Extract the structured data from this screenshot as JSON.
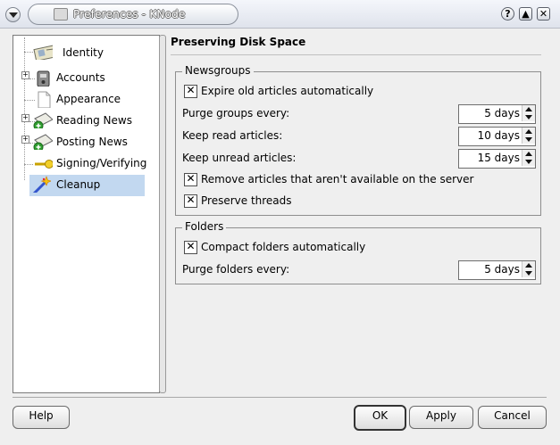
{
  "window": {
    "title": "Preferences - KNode",
    "help_glyph": "?",
    "shade_glyph": "▲",
    "close_glyph": "✕"
  },
  "tree": {
    "items": [
      {
        "label": "Identity",
        "icon": "identity-card-icon",
        "expandable": false
      },
      {
        "label": "Accounts",
        "icon": "accounts-icon",
        "expandable": true
      },
      {
        "label": "Appearance",
        "icon": "appearance-document-icon",
        "expandable": false
      },
      {
        "label": "Reading News",
        "icon": "reading-news-icon",
        "expandable": true
      },
      {
        "label": "Posting News",
        "icon": "posting-news-icon",
        "expandable": true
      },
      {
        "label": "Signing/Verifying",
        "icon": "key-icon",
        "expandable": false
      },
      {
        "label": "Cleanup",
        "icon": "magic-wand-icon",
        "expandable": false,
        "selected": true
      }
    ],
    "expander_glyph": "+"
  },
  "page": {
    "title": "Preserving Disk Space",
    "newsgroups": {
      "title": "Newsgroups",
      "expire_label": "Expire old articles automatically",
      "expire_checked": true,
      "purge_label": "Purge groups every:",
      "purge_value": "5 days",
      "keep_read_label": "Keep read articles:",
      "keep_read_value": "10 days",
      "keep_unread_label": "Keep unread articles:",
      "keep_unread_value": "15 days",
      "remove_label": "Remove articles that aren't available on the server",
      "remove_checked": true,
      "preserve_label": "Preserve threads",
      "preserve_checked": true
    },
    "folders": {
      "title": "Folders",
      "compact_label": "Compact folders automatically",
      "compact_checked": true,
      "purge_label": "Purge folders every:",
      "purge_value": "5 days"
    },
    "check_glyph": "✕"
  },
  "buttons": {
    "help": "Help",
    "ok": "OK",
    "apply": "Apply",
    "cancel": "Cancel"
  },
  "colors": {
    "selection": "#c2d8f0",
    "window_bg": "#efefef"
  }
}
